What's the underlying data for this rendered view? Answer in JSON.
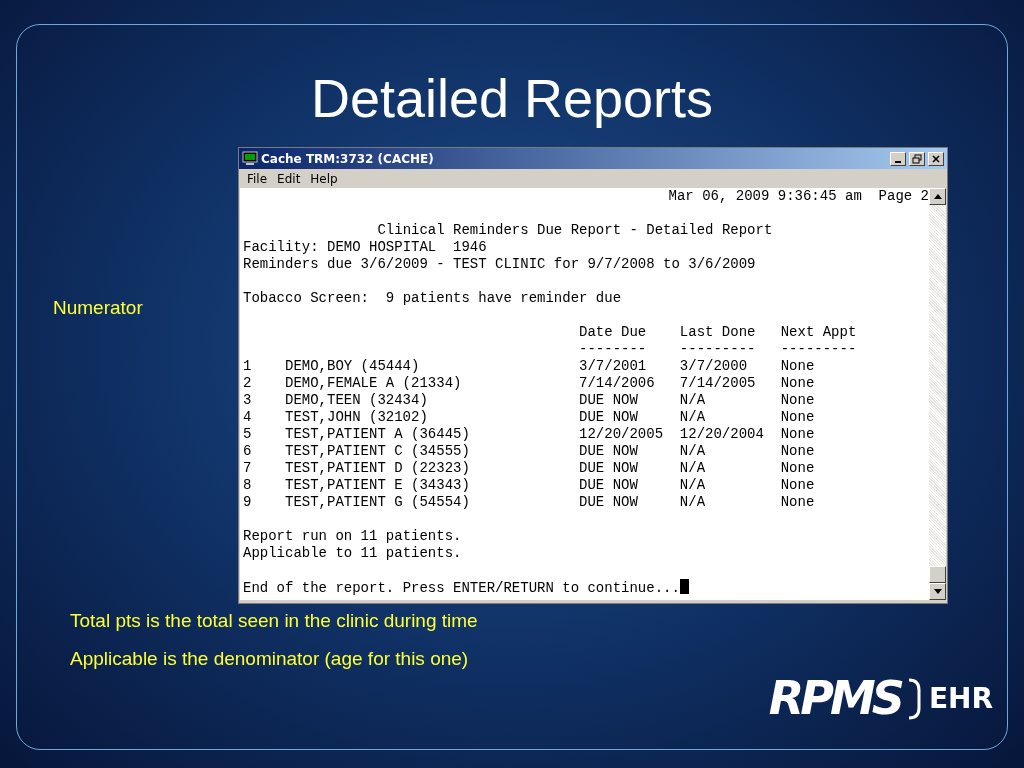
{
  "slide": {
    "title": "Detailed Reports",
    "side_label": "Numerator",
    "captions": [
      "Total pts is the total seen in the clinic during time",
      "Applicable is the denominator (age for this one)"
    ],
    "logo": {
      "main": "RPMS",
      "suffix": "EHR"
    }
  },
  "window": {
    "title": "Cache TRM:3732 (CACHE)",
    "menu": [
      "File",
      "Edit",
      "Help"
    ]
  },
  "terminal": {
    "lines": [
      {
        "kind": "timestamp",
        "text": "Mar 06, 2009 9:36:45 am  Page 2"
      },
      {
        "kind": "blank"
      },
      {
        "kind": "title",
        "text": "Clinical Reminders Due Report - Detailed Report"
      },
      {
        "kind": "plain",
        "text": "Facility: DEMO HOSPITAL  1946"
      },
      {
        "kind": "plain",
        "text": "Reminders due 3/6/2009 - TEST CLINIC for 9/7/2008 to 3/6/2009"
      },
      {
        "kind": "blank"
      },
      {
        "kind": "plain",
        "text": "Tobacco Screen:  9 patients have reminder due"
      },
      {
        "kind": "blank"
      }
    ],
    "columns": [
      {
        "label": "Date Due",
        "rule": "--------"
      },
      {
        "label": "Last Done",
        "rule": "---------"
      },
      {
        "label": "Next Appt",
        "rule": "---------"
      }
    ],
    "rows": [
      {
        "num": "1",
        "name": "DEMO,BOY (45444)",
        "date_due": "3/7/2001",
        "last_done": "3/7/2000",
        "next_appt": "None"
      },
      {
        "num": "2",
        "name": "DEMO,FEMALE A (21334)",
        "date_due": "7/14/2006",
        "last_done": "7/14/2005",
        "next_appt": "None"
      },
      {
        "num": "3",
        "name": "DEMO,TEEN (32434)",
        "date_due": "DUE NOW",
        "last_done": "N/A",
        "next_appt": "None"
      },
      {
        "num": "4",
        "name": "TEST,JOHN (32102)",
        "date_due": "DUE NOW",
        "last_done": "N/A",
        "next_appt": "None"
      },
      {
        "num": "5",
        "name": "TEST,PATIENT A (36445)",
        "date_due": "12/20/2005",
        "last_done": "12/20/2004",
        "next_appt": "None"
      },
      {
        "num": "6",
        "name": "TEST,PATIENT C (34555)",
        "date_due": "DUE NOW",
        "last_done": "N/A",
        "next_appt": "None"
      },
      {
        "num": "7",
        "name": "TEST,PATIENT D (22323)",
        "date_due": "DUE NOW",
        "last_done": "N/A",
        "next_appt": "None"
      },
      {
        "num": "8",
        "name": "TEST,PATIENT E (34343)",
        "date_due": "DUE NOW",
        "last_done": "N/A",
        "next_appt": "None"
      },
      {
        "num": "9",
        "name": "TEST,PATIENT G (54554)",
        "date_due": "DUE NOW",
        "last_done": "N/A",
        "next_appt": "None"
      }
    ],
    "footer": [
      {
        "kind": "blank"
      },
      {
        "kind": "plain",
        "text": "Report run on 11 patients."
      },
      {
        "kind": "plain",
        "text": "Applicable to 11 patients."
      },
      {
        "kind": "blank"
      },
      {
        "kind": "prompt",
        "text": "End of the report. Press ENTER/RETURN to continue..."
      }
    ]
  }
}
